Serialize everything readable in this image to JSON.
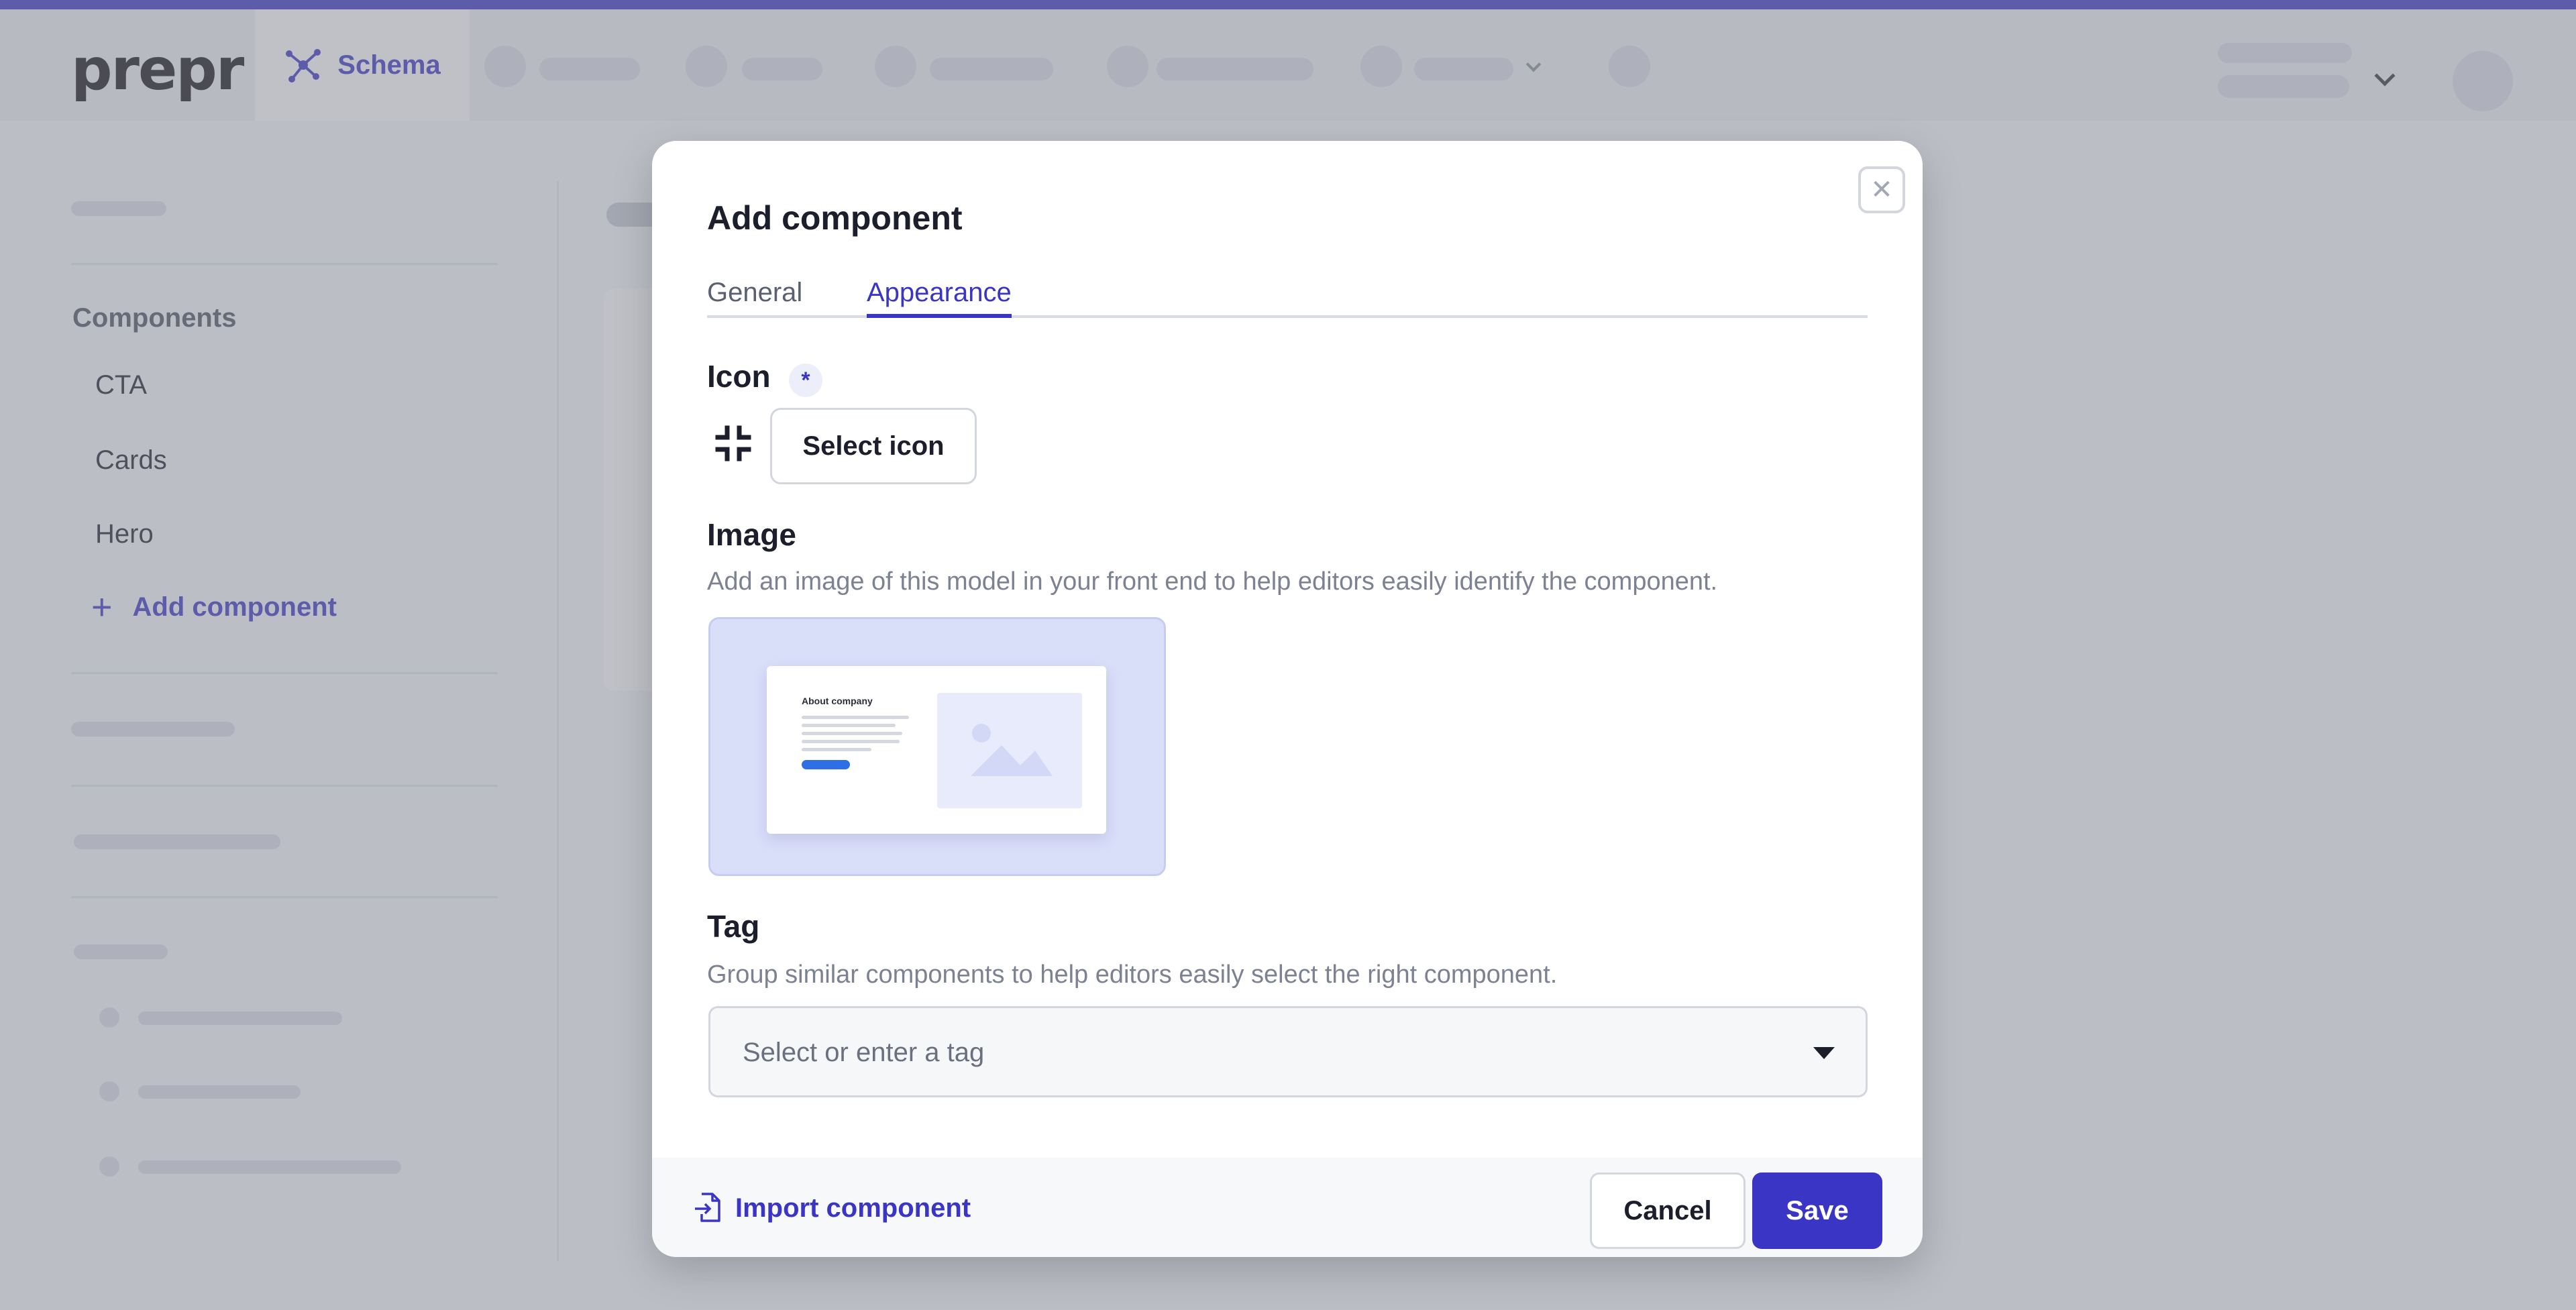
{
  "brand": {
    "logo_text": "prepr",
    "accent": "#3b35c5"
  },
  "topbar": {
    "active_tab": "Schema"
  },
  "sidebar": {
    "heading": "Components",
    "items": [
      "CTA",
      "Cards",
      "Hero"
    ],
    "add_label": "Add component"
  },
  "modal": {
    "title": "Add component",
    "tabs": [
      {
        "label": "General",
        "active": false
      },
      {
        "label": "Appearance",
        "active": true
      }
    ],
    "icon_field": {
      "label": "Icon",
      "required_mark": "*",
      "select_button": "Select icon",
      "current_icon": "shrink-icon"
    },
    "image_field": {
      "label": "Image",
      "help": "Add an image of this model in your front end to help editors easily identify the component.",
      "preview_title": "About company"
    },
    "tag_field": {
      "label": "Tag",
      "help": "Group similar components to help editors easily select the right component.",
      "placeholder": "Select or enter a tag"
    },
    "footer": {
      "import_label": "Import component",
      "cancel_label": "Cancel",
      "save_label": "Save"
    },
    "close_icon": "close-icon"
  }
}
